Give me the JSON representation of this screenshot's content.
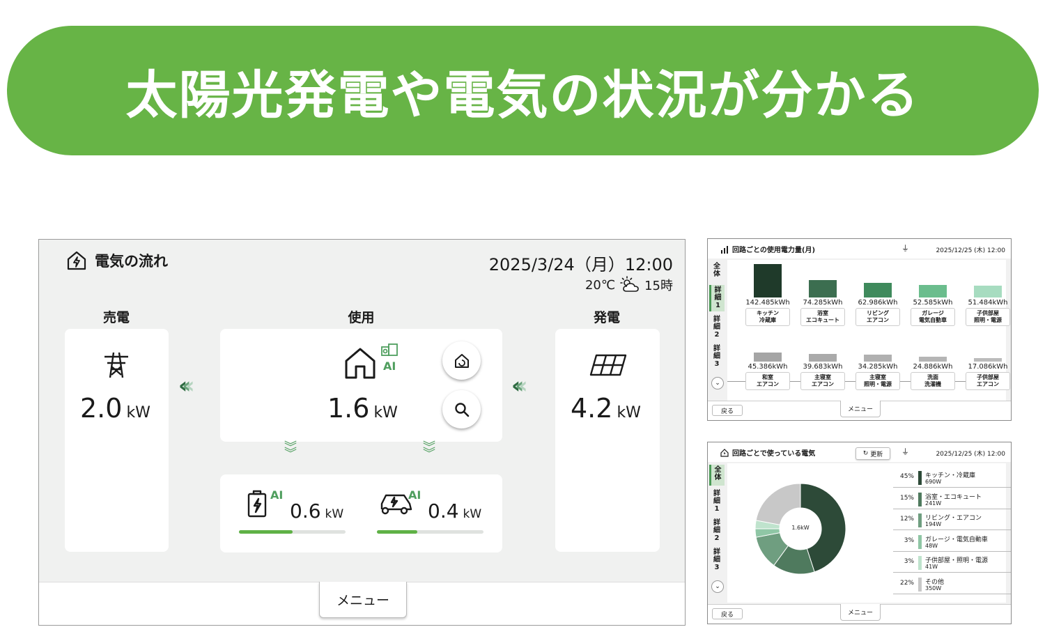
{
  "banner": {
    "title": "太陽光発電や電気の状況が分かる"
  },
  "main": {
    "title": "電気の流れ",
    "datetime": "2025/3/24（月）12:00",
    "weather": {
      "temp": "20℃",
      "icon": "partly-cloudy-icon",
      "hour": "15時"
    },
    "sell": {
      "label": "売電",
      "value": "2.0",
      "unit": "kW",
      "icon": "power-tower-icon"
    },
    "use": {
      "label": "使用",
      "value": "1.6",
      "unit": "kW",
      "icon": "house-icon",
      "ai": "AI"
    },
    "gen": {
      "label": "発電",
      "value": "4.2",
      "unit": "kW",
      "icon": "solar-panel-icon"
    },
    "battery": {
      "value": "0.6",
      "unit": "kW",
      "ai": "AI",
      "level": 0.5
    },
    "ev": {
      "value": "0.4",
      "unit": "kW",
      "ai": "AI",
      "level": 0.38
    },
    "menu": "メニュー"
  },
  "bar_screen": {
    "title": "回路ごとの使用電力量(月)",
    "date": "2025/12/25 (木) 12:00",
    "tabs": [
      "全体",
      "詳細1",
      "詳細2",
      "詳細3"
    ],
    "active_tab": 1,
    "back": "戻る",
    "menu": "メニュー",
    "row1": [
      {
        "value": "142.485kWh",
        "l1": "キッチン",
        "l2": "冷蔵庫",
        "color": "#1f3a2a",
        "h": 1.0
      },
      {
        "value": "74.285kWh",
        "l1": "浴室",
        "l2": "エコキュート",
        "color": "#3c6e50",
        "h": 0.52
      },
      {
        "value": "62.986kWh",
        "l1": "リビング",
        "l2": "エアコン",
        "color": "#3f8a5c",
        "h": 0.44
      },
      {
        "value": "52.585kWh",
        "l1": "ガレージ",
        "l2": "電気自動車",
        "color": "#6bbd8d",
        "h": 0.37
      },
      {
        "value": "51.484kWh",
        "l1": "子供部屋",
        "l2": "照明・電源",
        "color": "#a7dcc0",
        "h": 0.36
      }
    ],
    "row2": [
      {
        "value": "45.386kWh",
        "l1": "和室",
        "l2": "エアコン",
        "color": "#a5a5a5",
        "h": 0.32
      },
      {
        "value": "39.683kWh",
        "l1": "主寝室",
        "l2": "エアコン",
        "color": "#aaaaaa",
        "h": 0.28
      },
      {
        "value": "34.285kWh",
        "l1": "主寝室",
        "l2": "照明・電源",
        "color": "#b0b0b0",
        "h": 0.24
      },
      {
        "value": "24.886kWh",
        "l1": "洗面",
        "l2": "洗濯機",
        "color": "#b5b5b5",
        "h": 0.17
      },
      {
        "value": "17.086kWh",
        "l1": "子供部屋",
        "l2": "エアコン",
        "color": "#bbbbbb",
        "h": 0.12
      }
    ]
  },
  "pie_screen": {
    "title": "回路ごとで使っている電気",
    "refresh": "更新",
    "date": "2025/12/25 (木) 12:00",
    "tabs": [
      "全体",
      "詳細1",
      "詳細2",
      "詳細3"
    ],
    "active_tab": 0,
    "center": "1.6kW",
    "back": "戻る",
    "menu": "メニュー",
    "items": [
      {
        "pct": "45%",
        "name": "キッチン・冷蔵庫",
        "w": "690W",
        "color": "#2d4a38",
        "value": 45
      },
      {
        "pct": "15%",
        "name": "浴室・エコキュート",
        "w": "241W",
        "color": "#4f7a5e",
        "value": 15
      },
      {
        "pct": "12%",
        "name": "リビング・エアコン",
        "w": "194W",
        "color": "#6f9e80",
        "value": 12
      },
      {
        "pct": "3%",
        "name": "ガレージ・電気自動車",
        "w": "48W",
        "color": "#8fc6a5",
        "value": 3
      },
      {
        "pct": "3%",
        "name": "子供部屋・照明・電源",
        "w": "41W",
        "color": "#bfe3cd",
        "value": 3
      },
      {
        "pct": "22%",
        "name": "その他",
        "w": "350W",
        "color": "#c8c8c8",
        "value": 22
      }
    ]
  }
}
